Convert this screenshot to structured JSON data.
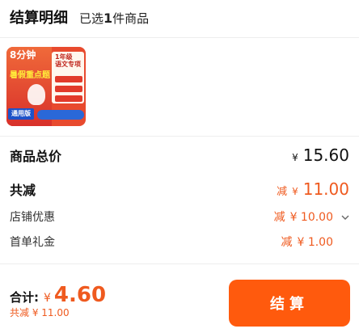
{
  "header": {
    "title": "结算明细",
    "selected_prefix": "已选",
    "selected_count": "1",
    "selected_suffix": "件商品"
  },
  "product": {
    "thumbnail_text_1": "8分钟",
    "thumbnail_text_2": "暑假重点题",
    "thumbnail_grade": "1年级",
    "thumbnail_sub": "语文专项",
    "thumbnail_badge": "通用版"
  },
  "summary": {
    "goods_total_label": "商品总价",
    "goods_total_symbol": "¥",
    "goods_total_value": "15.60",
    "total_discount_label": "共减",
    "total_discount_minus": "减",
    "total_discount_symbol": "¥",
    "total_discount_value": "11.00",
    "store_discount_label": "店铺优惠",
    "store_discount_minus": "减",
    "store_discount_value": "¥ 10.00",
    "first_order_label": "首单礼金",
    "first_order_minus": "减",
    "first_order_value": "¥ 1.00"
  },
  "footer": {
    "total_label": "合计:",
    "total_symbol": "¥",
    "total_value": "4.60",
    "discount_text": "共减 ¥ 11.00",
    "checkout_label": "结算"
  },
  "colors": {
    "accent": "#ff5a0d",
    "price_orange": "#ef5a1f"
  },
  "icons": {
    "store_discount_expand": "chevron-down-icon"
  }
}
